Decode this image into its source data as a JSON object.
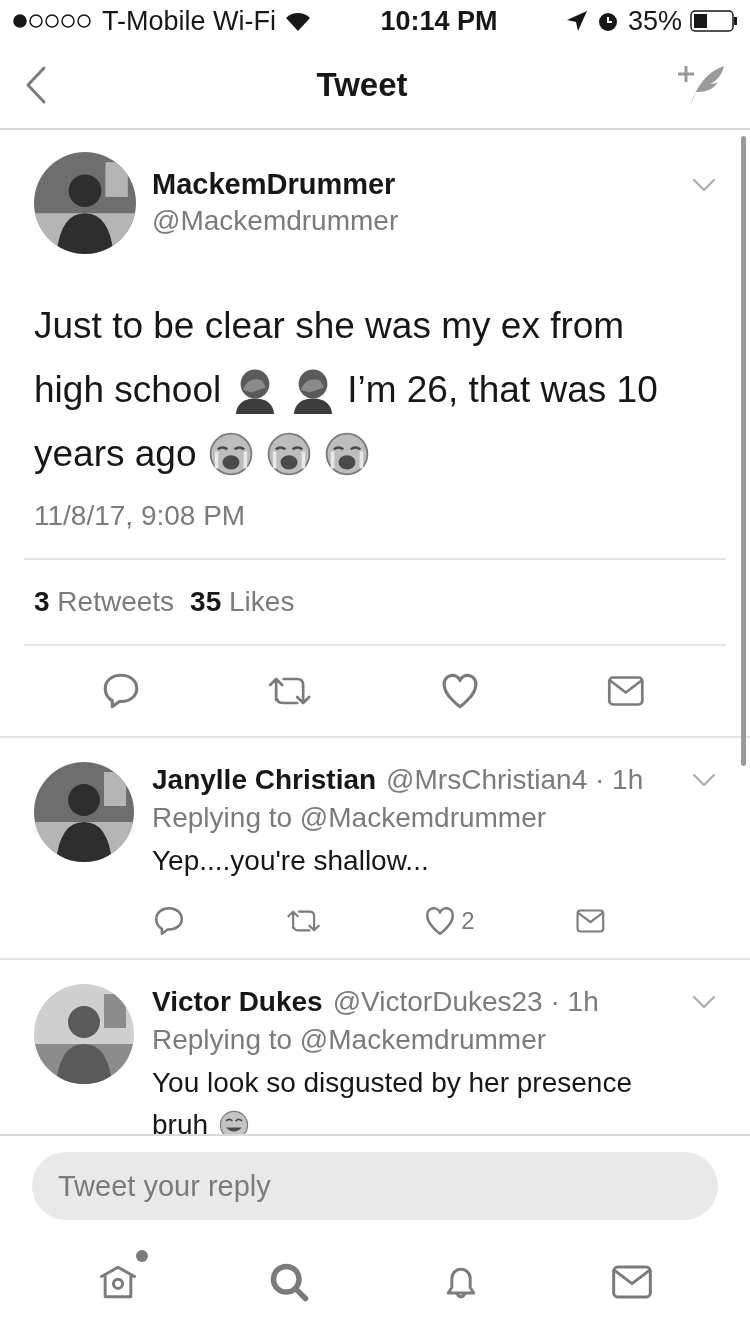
{
  "status_bar": {
    "carrier": "T-Mobile Wi-Fi",
    "time": "10:14 PM",
    "battery": "35%"
  },
  "nav": {
    "title": "Tweet"
  },
  "tweet": {
    "name": "MackemDrummer",
    "handle": "@Mackemdrummer",
    "body": [
      [
        {
          "kind": "text",
          "text": "Just to be clear she was my ex from"
        }
      ],
      [
        {
          "kind": "text",
          "text": "high school"
        },
        {
          "kind": "facepalm"
        },
        {
          "kind": "facepalm"
        },
        {
          "kind": "text",
          "text": "I’m 26, that was 10"
        }
      ],
      [
        {
          "kind": "text",
          "text": "years ago"
        },
        {
          "kind": "crying"
        },
        {
          "kind": "crying"
        },
        {
          "kind": "crying"
        }
      ]
    ],
    "timestamp": "11/8/17, 9:08 PM",
    "stats": [
      {
        "count": "3",
        "label": "Retweets"
      },
      {
        "count": "35",
        "label": "Likes"
      }
    ]
  },
  "replies": [
    {
      "name": "Janylle Christian",
      "meta": "@MrsChristian4 · 1h",
      "replying_to": "Replying to @Mackemdrummer",
      "body": [
        [
          {
            "kind": "text",
            "text": "Yep....you're shallow..."
          }
        ]
      ],
      "likes": "2",
      "actions": true
    },
    {
      "name": "Victor Dukes",
      "meta": "@VictorDukes23 · 1h",
      "replying_to": "Replying to @Mackemdrummer",
      "body": [
        [
          {
            "kind": "text",
            "text": "You look so disgusted by her presence"
          }
        ],
        [
          {
            "kind": "text",
            "text": "bruh"
          },
          {
            "kind": "joy"
          }
        ]
      ],
      "actions": false
    }
  ],
  "reply_box": {
    "placeholder": "Tweet your reply"
  },
  "tab_bar": [
    {
      "kind": "home",
      "badge": true
    },
    {
      "kind": "search",
      "badge": false
    },
    {
      "kind": "notifications",
      "badge": false
    },
    {
      "kind": "messages",
      "badge": false
    }
  ]
}
